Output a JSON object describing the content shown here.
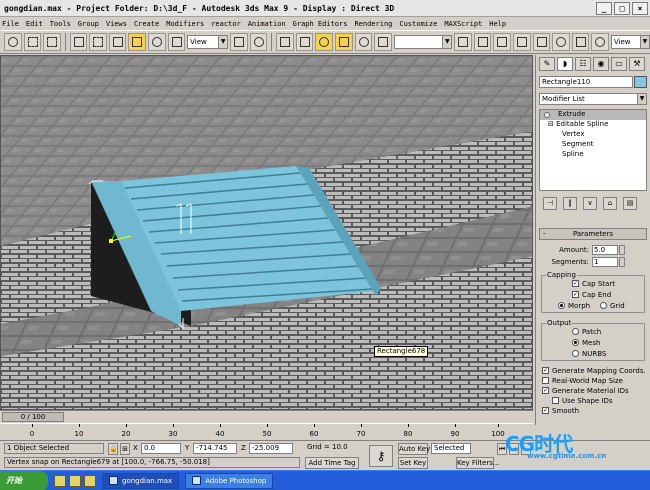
{
  "titlebar": {
    "file": "gongdian.max",
    "separator1": "-",
    "project": "Project Folder: D:\\3d_F",
    "separator2": "-",
    "app": "Autodesk 3ds Max 9",
    "separator3": "-",
    "display": "Display : Direct 3D"
  },
  "menu": [
    "File",
    "Edit",
    "Tools",
    "Group",
    "Views",
    "Create",
    "Modifiers",
    "reactor",
    "Animation",
    "Graph Editors",
    "Rendering",
    "Customize",
    "MAXScript",
    "Help"
  ],
  "toolbar": {
    "viewport_select": "View",
    "view_right": "View",
    "named_selection": ""
  },
  "viewport": {
    "tooltip": "Rectangle678"
  },
  "command_panel": {
    "object_name": "Rectangle110",
    "object_color": "#86c6de",
    "modifier_list": "Modifier List",
    "stack": [
      {
        "label": "Extrude",
        "selected": true
      },
      {
        "label": "Editable Spline",
        "selected": false
      },
      {
        "label": "Vertex",
        "selected": false
      },
      {
        "label": "Segment",
        "selected": false
      },
      {
        "label": "Spline",
        "selected": false
      }
    ],
    "parameters": {
      "title": "Parameters",
      "amount_label": "Amount:",
      "amount_value": "5.0",
      "segments_label": "Segments:",
      "segments_value": "1",
      "capping_title": "Capping",
      "cap_start": "Cap Start",
      "cap_end": "Cap End",
      "morph": "Morph",
      "grid": "Grid",
      "output_title": "Output",
      "patch": "Patch",
      "mesh": "Mesh",
      "nurbs": "NURBS",
      "gen_mapping": "Generate Mapping Coords.",
      "real_world": "Real-World Map Size",
      "gen_material": "Generate Material IDs",
      "use_shape_ids": "Use Shape IDs",
      "smooth": "Smooth"
    }
  },
  "timeline": {
    "slider": "0 / 100",
    "ticks": [
      "0",
      "10",
      "20",
      "30",
      "40",
      "50",
      "60",
      "70",
      "80",
      "90",
      "100"
    ]
  },
  "status": {
    "selection": "1 Object Selected",
    "prompt": "Vertex snap on Rectangle679 at [100.0, -766.75, -50.018]",
    "x_label": "X",
    "x_value": "0.0",
    "y_label": "Y",
    "y_value": "-714.745",
    "z_label": "Z",
    "z_value": "-25.009",
    "grid": "Grid = 10.0",
    "add_time_tag": "Add Time Tag",
    "auto_key": "Auto Key",
    "set_key": "Set Key",
    "key_filter_sel": "Selected",
    "key_filters": "Key Filters..."
  },
  "taskbar": {
    "start": "开始",
    "task1": "gongdian.max",
    "task2": "Adobe Photoshop"
  },
  "watermark": {
    "main": "CG时代",
    "sub": "www.cgtime.com.cn"
  }
}
